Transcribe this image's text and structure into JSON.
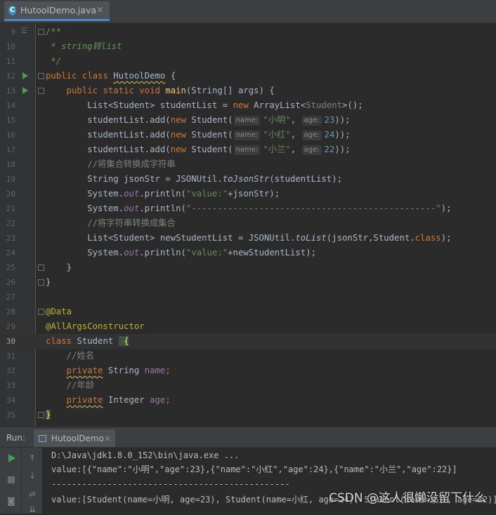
{
  "editor_tab": {
    "icon_letter": "C",
    "filename": "HutoolDemo.java",
    "close": "×"
  },
  "lines": [
    {
      "n": "9"
    },
    {
      "n": "10"
    },
    {
      "n": "11"
    },
    {
      "n": "12"
    },
    {
      "n": "13"
    },
    {
      "n": "14"
    },
    {
      "n": "15"
    },
    {
      "n": "16"
    },
    {
      "n": "17"
    },
    {
      "n": "18"
    },
    {
      "n": "19"
    },
    {
      "n": "20"
    },
    {
      "n": "21"
    },
    {
      "n": "22"
    },
    {
      "n": "23"
    },
    {
      "n": "24"
    },
    {
      "n": "25"
    },
    {
      "n": "26"
    },
    {
      "n": "27"
    },
    {
      "n": "28"
    },
    {
      "n": "29"
    },
    {
      "n": "30"
    },
    {
      "n": "31"
    },
    {
      "n": "32"
    },
    {
      "n": "33"
    },
    {
      "n": "34"
    },
    {
      "n": "35"
    }
  ],
  "code": {
    "l9": "/**",
    "l10": " * string转list",
    "l11": " */",
    "kw_public": "public",
    "kw_class": "class",
    "kw_static": "static",
    "kw_void": "void",
    "kw_new": "new",
    "kw_private": "private",
    "class_name": "HutoolDemo",
    "open_brace": " {",
    "main": "main",
    "main_args": "(String[] args) {",
    "list_decl": "List<Student> studentList = ",
    "arraylist": "ArrayList<",
    "student_generic": "Student",
    "arraylist_close": ">();",
    "add_call": "studentList.add(",
    "student_ctor": "Student(",
    "hint_name": "name:",
    "hint_age": "age:",
    "s_xiaoming": "\"小明\"",
    "s_xiaohong": "\"小红\"",
    "s_xiaolan": "\"小兰\"",
    "age_23": "23",
    "age_24": "24",
    "age_22": "22",
    "comma": ", ",
    "close_call": "));",
    "comment18": "//将集合转换成字符串",
    "json_decl": "String jsonStr = JSONUtil.",
    "to_json_str": "toJsonStr",
    "json_args": "(studentList);",
    "sys": "System.",
    "out": "out",
    "println": ".println(",
    "s_value": "\"value:\"",
    "plus_json": "+jsonStr);",
    "s_dashes": "\"-----------------------------------------------\"",
    "close_paren": ");",
    "comment22": "//将字符串转换成集合",
    "new_list_decl": "List<Student> newStudentList = JSONUtil.",
    "to_list": "toList",
    "to_list_args": "(jsonStr,Student.",
    "kw_class_ref": "class",
    "plus_new_list": "+newStudentList);",
    "close_brace": "}",
    "ann_data": "@Data",
    "ann_all_args": "@AllArgsConstructor",
    "student_class": "Student",
    "comment31": "//姓名",
    "type_string": "String",
    "field_name": "name",
    "semicolon": ";",
    "comment33": "//年龄",
    "type_integer": "Integer",
    "field_age": "age"
  },
  "run_panel": {
    "label": "Run:",
    "tab_name": "HutoolDemo",
    "tab_close": "×",
    "console": [
      "D:\\Java\\jdk1.8.0_152\\bin\\java.exe ...",
      "value:[{\"name\":\"小明\",\"age\":23},{\"name\":\"小红\",\"age\":24},{\"name\":\"小兰\",\"age\":22}]",
      "-----------------------------------------------",
      "value:[Student(name=小明, age=23), Student(name=小红, age=24), Student(name=小兰, age=22)]"
    ],
    "tools": {
      "up": "↑",
      "down": "↓",
      "wrap": "⇌",
      "camera": "◙",
      "pin": "⇊"
    }
  },
  "watermark": "CSDN @这人很懒没留下什么"
}
